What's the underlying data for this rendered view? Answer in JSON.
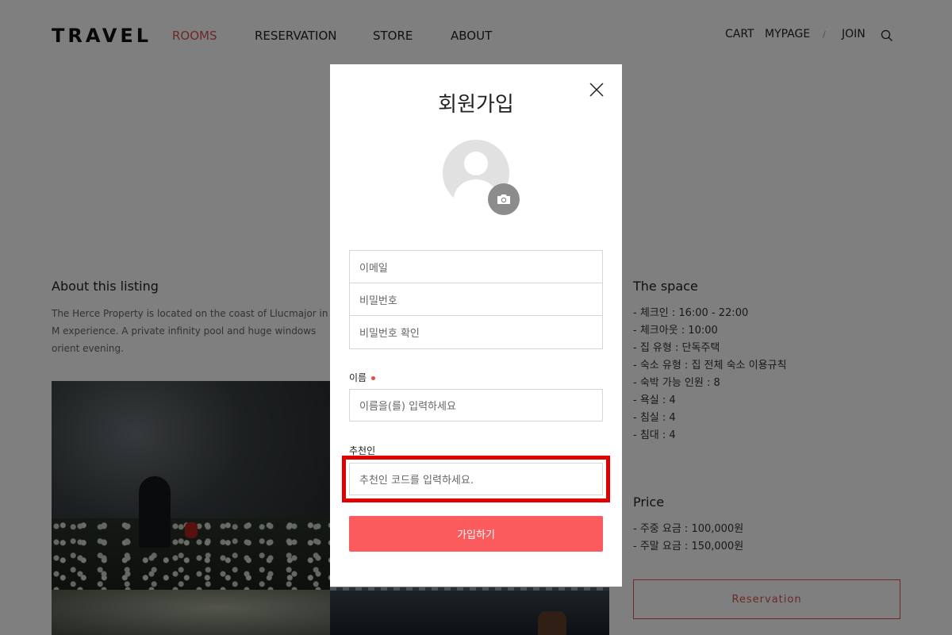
{
  "header": {
    "logo": "TRAVEL",
    "nav": [
      {
        "label": "ROOMS",
        "active": true
      },
      {
        "label": "RESERVATION"
      },
      {
        "label": "STORE"
      },
      {
        "label": "ABOUT"
      }
    ],
    "util": {
      "cart": "CART",
      "mypage": "MYPAGE",
      "separator": "/",
      "join": "JOIN"
    }
  },
  "listing": {
    "about_title": "About this listing",
    "about_text": "The Herce Property is located on the coast of Llucmajor in M experience. A private infinity pool and huge windows orient evening.",
    "space_title": "The space",
    "space_items": [
      "- 체크인 : 16:00 - 22:00",
      "- 체크아웃 : 10:00",
      "- 집 유형 : 단독주택",
      "- 숙소 유형 : 집 전체 숙소 이용규칙",
      "- 숙박 가능 인원 : 8",
      "- 욕실 : 4",
      "- 침실 : 4",
      "- 침대 : 4"
    ],
    "price_title": "Price",
    "price_items": [
      "- 주중 요금 : 100,000원",
      "- 주말 요금 : 150,000원"
    ],
    "reservation_label": "Reservation"
  },
  "modal": {
    "title": "회원가입",
    "email_placeholder": "이메일",
    "password_placeholder": "비밀번호",
    "password_confirm_placeholder": "비밀번호 확인",
    "name_label": "이름",
    "name_placeholder": "이름을(를) 입력하세요",
    "referrer_label": "추천인",
    "referrer_placeholder": "추천인 코드를 입력하세요.",
    "submit_label": "가입하기"
  },
  "colors": {
    "accent": "#fc5b5d",
    "nav_active": "#d9534f",
    "highlight": "#e00000",
    "required_dot": "#e74c3c"
  },
  "icons": [
    "search-icon",
    "close-icon",
    "camera-icon",
    "avatar-placeholder"
  ]
}
